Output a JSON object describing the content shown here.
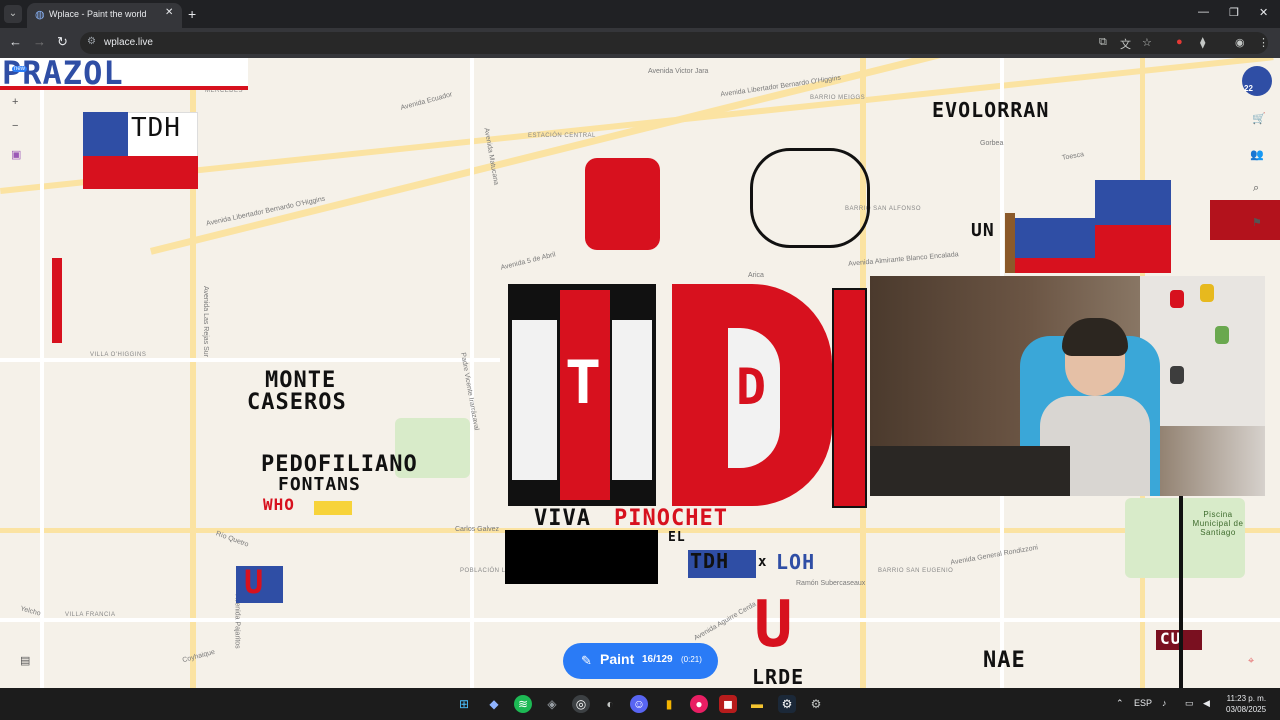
{
  "browser": {
    "tab_title": "Wplace - Paint the world",
    "url": "wplace.live"
  },
  "map": {
    "streets": [
      "Avenida Victor Jara",
      "Avenida Libertador Bernardo O'Higgins",
      "Avenida Ecuador",
      "Avenida Libertador Bernardo O'Higgins",
      "Avenida 5 de Abril",
      "Avenida Almirante Blanco Encalada",
      "Avenida Las Rejas Sur",
      "Padre Vicente Irarrázaval",
      "Avenida General Rondizzoni",
      "Ramón Subercaseaux",
      "Avenida Aguirre Cerda",
      "Avenida Pajaritos",
      "Coyhaique",
      "Río Quetro",
      "Yelcho",
      "Carlos Galvez",
      "Gorbea",
      "Toesca",
      "Avenida Matucana",
      "Arica"
    ],
    "districts": [
      "BARRIO MEIGGS",
      "ESTACIÓN CENTRAL",
      "VILLA O'HIGGINS",
      "VILLA FRANCIA",
      "POBLACIÓN LOS NOGALES",
      "BARRIO SAN EUGENIO",
      "BARRIO SAN ALFONSO",
      "MERCEDES"
    ],
    "park_label": "Piscina Municipal de Santiago"
  },
  "pixel_art": {
    "top_banner": "PRAZOL",
    "flag_text": "TDH",
    "top_right_text": "EVOLORRAN",
    "monte": "MONTE",
    "caseros": "CASEROS",
    "pedofiliano": "PEDOFILIANO",
    "fontans": "FONTANS",
    "who": "WHO",
    "viva": "VIVA",
    "pinochet": "PINOCHET",
    "el": "EL",
    "tdh_bottom": "TDH",
    "x": "x",
    "loh": "LOH",
    "nae": "NAE",
    "u_letter": "U",
    "lore": "LRDE",
    "big_t": "T",
    "big_d": "D",
    "un": "UN",
    "cu": "CU"
  },
  "sidebar": {
    "badge_count": "22",
    "new_badge": "new"
  },
  "paint_button": {
    "label": "Paint",
    "count": "16/129",
    "timer": "(0:21)"
  },
  "taskbar": {
    "language": "ESP",
    "time": "11:23 p. m.",
    "date": "03/08/2025"
  },
  "colors": {
    "accent": "#2a7bf6",
    "red": "#d7111e",
    "blue": "#2f4ea5"
  }
}
